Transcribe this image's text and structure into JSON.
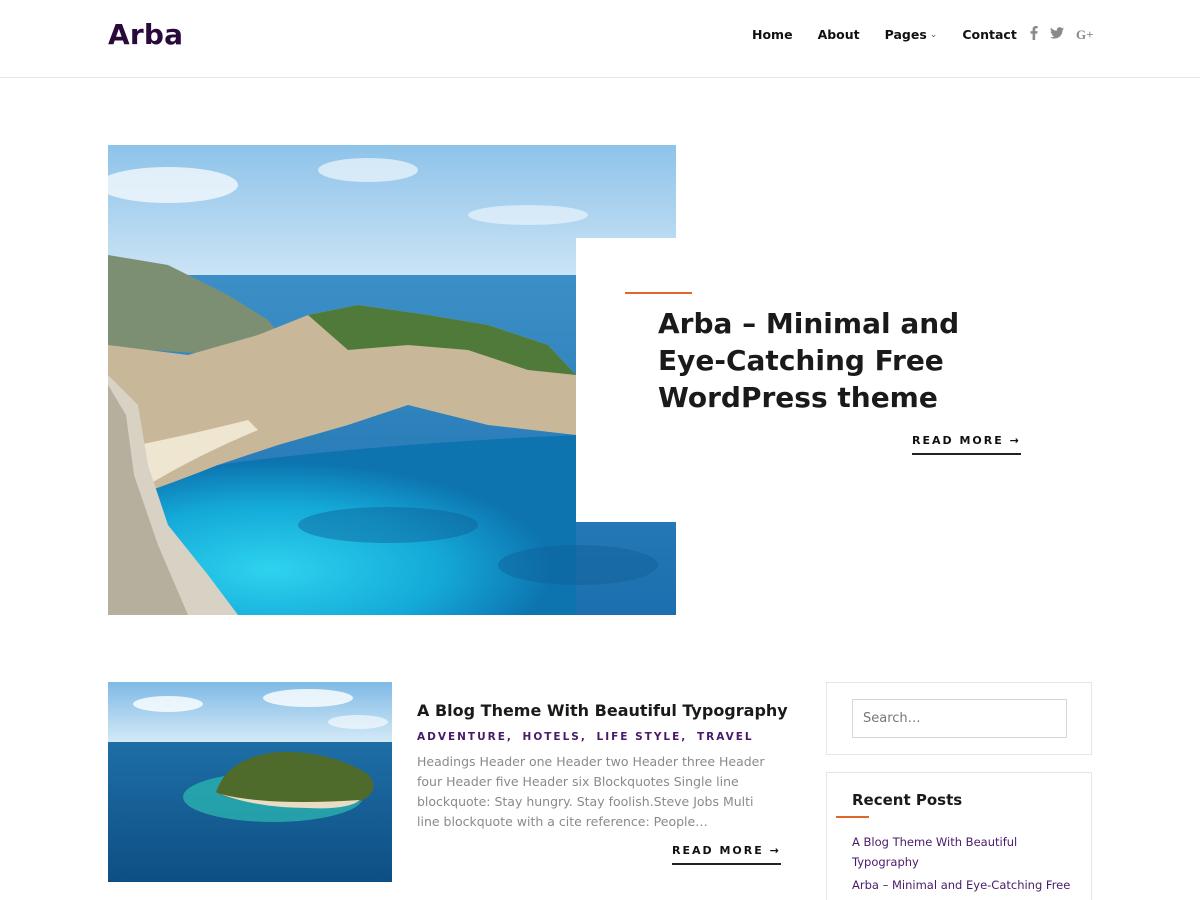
{
  "site": {
    "logo": "Arba"
  },
  "nav": [
    {
      "label": "Home"
    },
    {
      "label": "About"
    },
    {
      "label": "Pages"
    },
    {
      "label": "Contact"
    }
  ],
  "social": [
    {
      "icon": "facebook-icon",
      "glyph": "f"
    },
    {
      "icon": "twitter-icon",
      "glyph": "🐦"
    },
    {
      "icon": "google-plus-icon",
      "glyph": "G+"
    }
  ],
  "hero": {
    "title": "Arba – Minimal and Eye-Catching Free WordPress theme",
    "read_more": "READ MORE →"
  },
  "post": {
    "title": "A Blog Theme With Beautiful Typography",
    "categories": [
      "ADVENTURE",
      "HOTELS",
      "LIFE STYLE",
      "TRAVEL"
    ],
    "excerpt": "Headings Header one Header two Header three Header four Header five Header six Blockquotes Single line blockquote: Stay hungry. Stay foolish.Steve Jobs Multi line blockquote with a cite reference: People…",
    "read_more": "READ MORE →"
  },
  "sidebar": {
    "search": {
      "placeholder": "Search…"
    },
    "recent_posts": {
      "title": "Recent Posts",
      "items": [
        "A Blog Theme With Beautiful Typography",
        "Arba – Minimal and Eye-Catching Free WordPress theme"
      ]
    }
  },
  "colors": {
    "accent": "#e0662c",
    "brand": "#2a0a3a",
    "category": "#4a1a6a"
  }
}
